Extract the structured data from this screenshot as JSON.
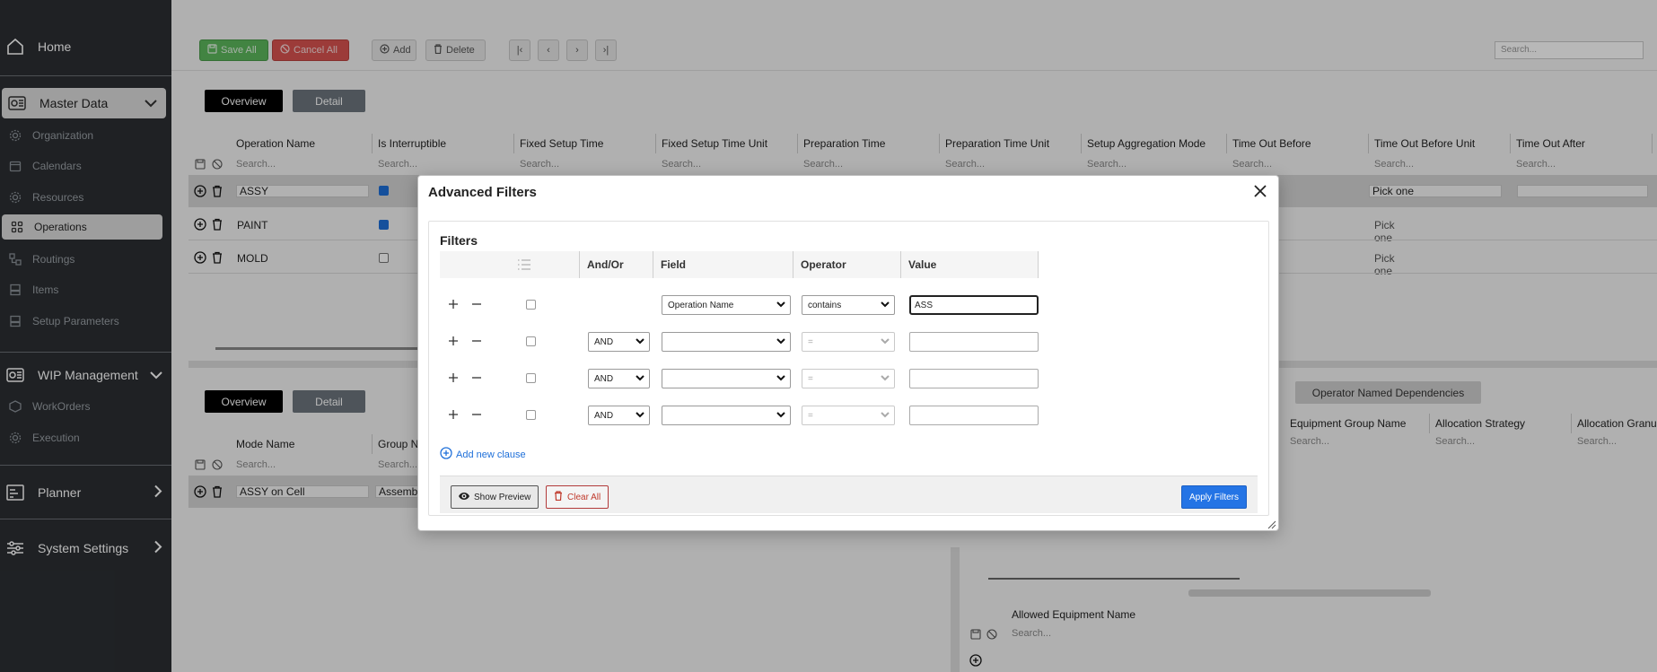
{
  "sidebar": {
    "home": "Home",
    "master_data": "Master Data",
    "master_items": [
      "Organization",
      "Calendars",
      "Resources",
      "Operations",
      "Routings",
      "Items",
      "Setup Parameters"
    ],
    "wip": "WIP Management",
    "wip_items": [
      "WorkOrders",
      "Execution"
    ],
    "planner": "Planner",
    "system_settings": "System Settings"
  },
  "toolbar": {
    "save_all": "Save All",
    "cancel_all": "Cancel All",
    "add": "Add",
    "delete": "Delete",
    "search_placeholder": "Search..."
  },
  "tabs": {
    "overview": "Overview",
    "detail": "Detail"
  },
  "grid_top": {
    "columns": [
      "Operation Name",
      "Is Interruptible",
      "Fixed Setup Time",
      "Fixed Setup Time Unit",
      "Preparation Time",
      "Preparation Time Unit",
      "Setup Aggregation Mode",
      "Time Out Before",
      "Time Out Before Unit",
      "Time Out After"
    ],
    "search": "Search...",
    "rows": [
      {
        "name": "ASSY",
        "interruptible": true,
        "unit": "Pick one"
      },
      {
        "name": "PAINT",
        "interruptible": true,
        "unit": "Pick one"
      },
      {
        "name": "MOLD",
        "interruptible": false,
        "unit": "Pick one"
      }
    ]
  },
  "grid_bottom": {
    "columns": [
      "Mode Name",
      "Group N"
    ],
    "search": "Search...",
    "row": {
      "name": "ASSY on Cell",
      "group": "Assemb"
    },
    "right_tab": "Operator Named Dependencies",
    "right_columns": [
      "Equipment Group Name",
      "Allocation Strategy",
      "Allocation Granu"
    ],
    "equip_column": "Allowed Equipment Name"
  },
  "modal": {
    "title": "Advanced Filters",
    "filters_heading": "Filters",
    "headers": {
      "andor": "And/Or",
      "field": "Field",
      "operator": "Operator",
      "value": "Value"
    },
    "rows": [
      {
        "andor": "",
        "field": "Operation Name",
        "operator": "contains",
        "value": "ASS"
      },
      {
        "andor": "AND",
        "field": "",
        "operator": "=",
        "value": ""
      },
      {
        "andor": "AND",
        "field": "",
        "operator": "=",
        "value": ""
      },
      {
        "andor": "AND",
        "field": "",
        "operator": "=",
        "value": ""
      }
    ],
    "add_clause": "Add new clause",
    "show_preview": "Show Preview",
    "clear_all": "Clear All",
    "apply": "Apply Filters"
  }
}
